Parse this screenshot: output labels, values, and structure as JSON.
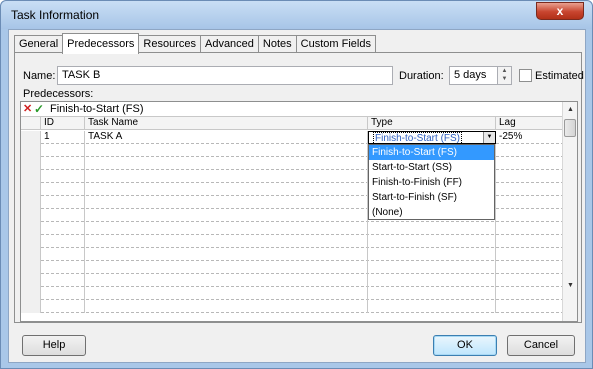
{
  "window": {
    "title": "Task Information",
    "close_label": "x"
  },
  "tabs": [
    "General",
    "Predecessors",
    "Resources",
    "Advanced",
    "Notes",
    "Custom Fields"
  ],
  "active_tab": "Predecessors",
  "form": {
    "name_label": "Name:",
    "name_value": "TASK B",
    "duration_label": "Duration:",
    "duration_value": "5 days",
    "estimated_label": "Estimated",
    "estimated_checked": false,
    "predecessors_label": "Predecessors:"
  },
  "grid": {
    "edit_value": "Finish-to-Start (FS)",
    "columns": [
      "ID",
      "Task Name",
      "Type",
      "Lag"
    ],
    "rows": [
      {
        "id": "1",
        "task_name": "TASK A",
        "type": "Finish-to-Start (FS)",
        "lag": "-25%"
      }
    ],
    "type_options": [
      "Finish-to-Start (FS)",
      "Start-to-Start (SS)",
      "Finish-to-Finish (FF)",
      "Start-to-Finish (SF)",
      "(None)"
    ],
    "selected_option_index": 0
  },
  "buttons": {
    "help": "Help",
    "ok": "OK",
    "cancel": "Cancel"
  }
}
